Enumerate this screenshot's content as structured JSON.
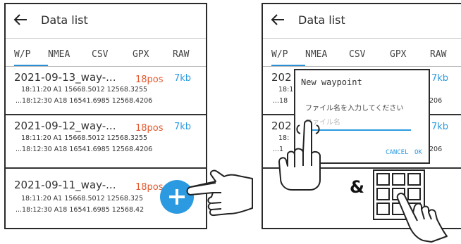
{
  "header": {
    "title": "Data list"
  },
  "tabs": [
    "W/P",
    "NMEA",
    "CSV",
    "GPX",
    "RAW"
  ],
  "active_tab": "W/P",
  "rows": [
    {
      "name": "2021-09-13_way-...",
      "pos": "18pos",
      "size": "7kb",
      "line1": "18:11:20 A1  15668.5012 12568.3255",
      "line2": "...18:12:30 A18  16541.6985 12568.4206"
    },
    {
      "name": "2021-09-12_way-...",
      "pos": "18pos",
      "size": "7kb",
      "line1": "18:11:20 A1  15668.5012 12568.3255",
      "line2": "...18:12:30 A18  16541.6985 12568.4206"
    },
    {
      "name": "2021-09-11_way-...",
      "pos": "18pos",
      "size": "",
      "line1": "18:11:20 A1  15668.5012 12568.325",
      "line2": "...18:12:30 A18  16541.6985 12568.42"
    }
  ],
  "right_rows": [
    {
      "name": "202",
      "size": "7kb",
      "line1": "18:1",
      "line2": "...18",
      "tail": "206"
    },
    {
      "name": "202",
      "size": "7kb",
      "line1": "18:",
      "line2": "...1",
      "tail": "206"
    }
  ],
  "dialog": {
    "title": "New waypoint",
    "prompt": "ファイル名を入力してください",
    "placeholder": "ファイル名",
    "cancel": "CANCEL",
    "ok": "OK"
  },
  "ampersand": "&",
  "colors": {
    "accent": "#2b9ae0",
    "pos": "#e3592f",
    "fab": "#2b9ae0"
  },
  "icons": [
    "back-arrow-icon",
    "plus-icon",
    "pointing-hand-icon",
    "tap-hand-icon",
    "keypad-icon"
  ]
}
